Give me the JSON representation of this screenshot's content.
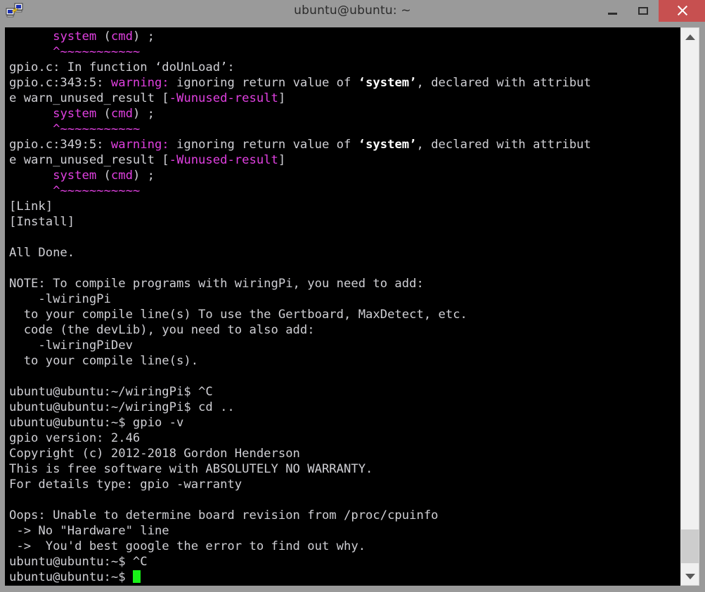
{
  "window": {
    "title": "ubuntu@ubuntu: ~",
    "icon": "putty-network-icon",
    "controls": {
      "minimize_label": "–",
      "maximize_label": "□",
      "close_label": "✕"
    },
    "colors": {
      "titlebar_bg": "#9a9a9a",
      "close_bg": "#c75050",
      "terminal_bg": "#000000",
      "terminal_fg": "#cfcfd4",
      "magenta": "#e040e0",
      "cursor_green": "#18f218"
    }
  },
  "scrollbar": {
    "up_arrow": "chevron-up-icon",
    "down_arrow": "chevron-down-icon",
    "thumb_position": "bottom"
  },
  "terminal": {
    "prompt_user_host": "ubuntu@ubuntu",
    "cursor": "block",
    "lines": [
      {
        "segments": [
          {
            "t": "      ",
            "c": "white"
          },
          {
            "t": "system",
            "c": "magenta"
          },
          {
            "t": " (",
            "c": "white"
          },
          {
            "t": "cmd",
            "c": "magenta"
          },
          {
            "t": ") ;",
            "c": "white"
          }
        ]
      },
      {
        "segments": [
          {
            "t": "      ",
            "c": "white"
          },
          {
            "t": "^~~~~~~~~~~~",
            "c": "magenta"
          }
        ]
      },
      {
        "segments": [
          {
            "t": "gpio.c: In function ‘doUnLoad’:",
            "c": "white"
          }
        ]
      },
      {
        "segments": [
          {
            "t": "gpio.c:343:5: ",
            "c": "white"
          },
          {
            "t": "warning:",
            "c": "magenta"
          },
          {
            "t": " ignoring return value of ",
            "c": "white"
          },
          {
            "t": "‘system’",
            "c": "bwhite"
          },
          {
            "t": ", declared with attribut",
            "c": "white"
          }
        ]
      },
      {
        "segments": [
          {
            "t": "e warn_unused_result [",
            "c": "white"
          },
          {
            "t": "-Wunused-result",
            "c": "magenta"
          },
          {
            "t": "]",
            "c": "white"
          }
        ]
      },
      {
        "segments": [
          {
            "t": "      ",
            "c": "white"
          },
          {
            "t": "system",
            "c": "magenta"
          },
          {
            "t": " (",
            "c": "white"
          },
          {
            "t": "cmd",
            "c": "magenta"
          },
          {
            "t": ") ;",
            "c": "white"
          }
        ]
      },
      {
        "segments": [
          {
            "t": "      ",
            "c": "white"
          },
          {
            "t": "^~~~~~~~~~~~",
            "c": "magenta"
          }
        ]
      },
      {
        "segments": [
          {
            "t": "gpio.c:349:5: ",
            "c": "white"
          },
          {
            "t": "warning:",
            "c": "magenta"
          },
          {
            "t": " ignoring return value of ",
            "c": "white"
          },
          {
            "t": "‘system’",
            "c": "bwhite"
          },
          {
            "t": ", declared with attribut",
            "c": "white"
          }
        ]
      },
      {
        "segments": [
          {
            "t": "e warn_unused_result [",
            "c": "white"
          },
          {
            "t": "-Wunused-result",
            "c": "magenta"
          },
          {
            "t": "]",
            "c": "white"
          }
        ]
      },
      {
        "segments": [
          {
            "t": "      ",
            "c": "white"
          },
          {
            "t": "system",
            "c": "magenta"
          },
          {
            "t": " (",
            "c": "white"
          },
          {
            "t": "cmd",
            "c": "magenta"
          },
          {
            "t": ") ;",
            "c": "white"
          }
        ]
      },
      {
        "segments": [
          {
            "t": "      ",
            "c": "white"
          },
          {
            "t": "^~~~~~~~~~~~",
            "c": "magenta"
          }
        ]
      },
      {
        "segments": [
          {
            "t": "[Link]",
            "c": "white"
          }
        ]
      },
      {
        "segments": [
          {
            "t": "[Install]",
            "c": "white"
          }
        ]
      },
      {
        "segments": [
          {
            "t": "",
            "c": "white"
          }
        ]
      },
      {
        "segments": [
          {
            "t": "All Done.",
            "c": "white"
          }
        ]
      },
      {
        "segments": [
          {
            "t": "",
            "c": "white"
          }
        ]
      },
      {
        "segments": [
          {
            "t": "NOTE: To compile programs with wiringPi, you need to add:",
            "c": "white"
          }
        ]
      },
      {
        "segments": [
          {
            "t": "    -lwiringPi",
            "c": "white"
          }
        ]
      },
      {
        "segments": [
          {
            "t": "  to your compile line(s) To use the Gertboard, MaxDetect, etc.",
            "c": "white"
          }
        ]
      },
      {
        "segments": [
          {
            "t": "  code (the devLib), you need to also add:",
            "c": "white"
          }
        ]
      },
      {
        "segments": [
          {
            "t": "    -lwiringPiDev",
            "c": "white"
          }
        ]
      },
      {
        "segments": [
          {
            "t": "  to your compile line(s).",
            "c": "white"
          }
        ]
      },
      {
        "segments": [
          {
            "t": "",
            "c": "white"
          }
        ]
      },
      {
        "segments": [
          {
            "t": "ubuntu@ubuntu:~/wiringPi$ ^C",
            "c": "white"
          }
        ]
      },
      {
        "segments": [
          {
            "t": "ubuntu@ubuntu:~/wiringPi$ cd ..",
            "c": "white"
          }
        ]
      },
      {
        "segments": [
          {
            "t": "ubuntu@ubuntu:~$ gpio -v",
            "c": "white"
          }
        ]
      },
      {
        "segments": [
          {
            "t": "gpio version: 2.46",
            "c": "white"
          }
        ]
      },
      {
        "segments": [
          {
            "t": "Copyright (c) 2012-2018 Gordon Henderson",
            "c": "white"
          }
        ]
      },
      {
        "segments": [
          {
            "t": "This is free software with ABSOLUTELY NO WARRANTY.",
            "c": "white"
          }
        ]
      },
      {
        "segments": [
          {
            "t": "For details type: gpio -warranty",
            "c": "white"
          }
        ]
      },
      {
        "segments": [
          {
            "t": "",
            "c": "white"
          }
        ]
      },
      {
        "segments": [
          {
            "t": "Oops: Unable to determine board revision from /proc/cpuinfo",
            "c": "white"
          }
        ]
      },
      {
        "segments": [
          {
            "t": " -> No \"Hardware\" line",
            "c": "white"
          }
        ]
      },
      {
        "segments": [
          {
            "t": " ->  You'd best google the error to find out why.",
            "c": "white"
          }
        ]
      },
      {
        "segments": [
          {
            "t": "ubuntu@ubuntu:~$ ^C",
            "c": "white"
          }
        ]
      },
      {
        "segments": [
          {
            "t": "ubuntu@ubuntu:~$ ",
            "c": "white"
          },
          {
            "t": "",
            "c": "cursor"
          }
        ]
      }
    ]
  }
}
